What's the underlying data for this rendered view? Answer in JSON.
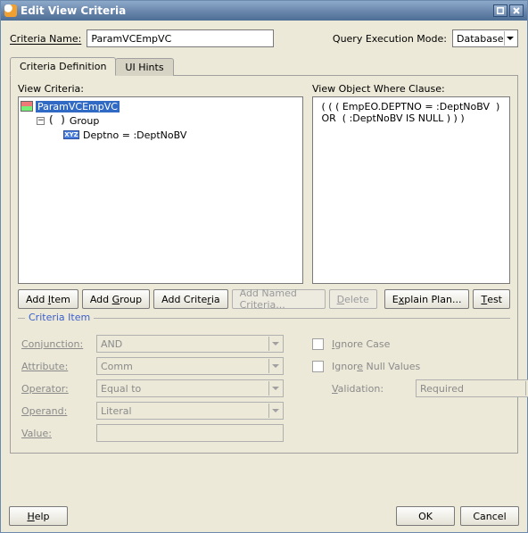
{
  "window": {
    "title": "Edit View Criteria"
  },
  "header": {
    "criteria_name_label": "Criteria Name:",
    "criteria_name_value": "ParamVCEmpVC",
    "exec_mode_label": "Query Execution Mode:",
    "exec_mode_value": "Database"
  },
  "tabs": {
    "def": "Criteria Definition",
    "hints": "UI Hints"
  },
  "left": {
    "label": "View Criteria:",
    "tree": {
      "root": "ParamVCEmpVC",
      "group": "Group",
      "leaf": "Deptno = :DeptNoBV",
      "leaf_icon_text": "XYZ"
    }
  },
  "right": {
    "label": "View Object Where Clause:",
    "clause_line1": " ( ( ( EmpEO.DEPTNO = :DeptNoBV  )",
    "clause_line2": " OR  ( :DeptNoBV IS NULL ) ) )"
  },
  "btns": {
    "add_item": "Add Item",
    "add_group": "Add Group",
    "add_criteria": "Add Criteria",
    "add_named": "Add Named Criteria...",
    "delete": "Delete",
    "explain": "Explain Plan...",
    "test": "Test"
  },
  "criteria_item": {
    "title": "Criteria Item",
    "conjunction_label": "Conjunction:",
    "conjunction_value": "AND",
    "attribute_label": "Attribute:",
    "attribute_value": "Comm",
    "operator_label": "Operator:",
    "operator_value": "Equal to",
    "operand_label": "Operand:",
    "operand_value": "Literal",
    "value_label": "Value:",
    "value_value": "",
    "ignore_case": "Ignore Case",
    "ignore_null": "Ignore Null Values",
    "validation_label": "Validation:",
    "validation_value": "Required"
  },
  "footer": {
    "help": "Help",
    "ok": "OK",
    "cancel": "Cancel"
  }
}
